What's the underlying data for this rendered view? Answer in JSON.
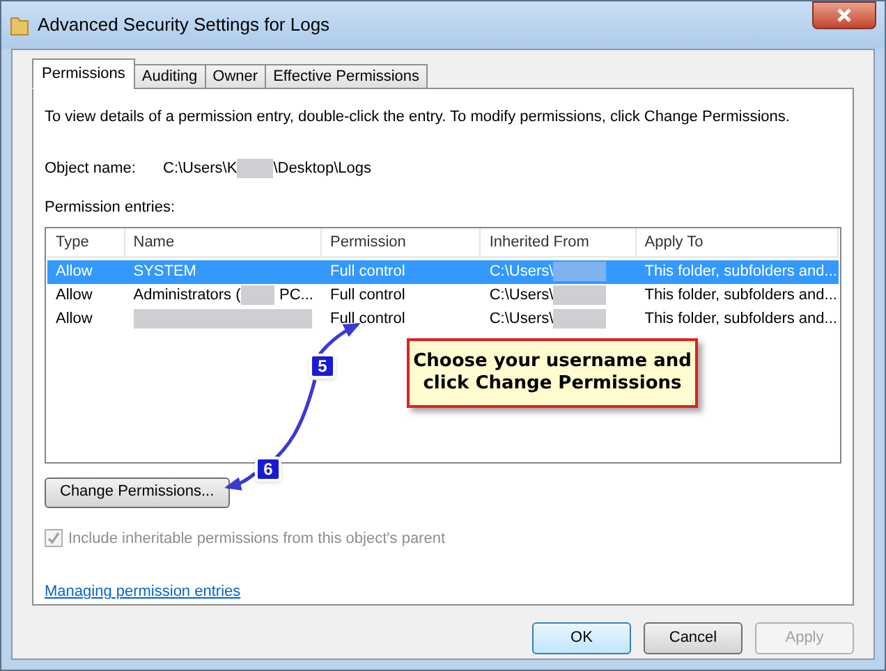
{
  "window": {
    "title": "Advanced Security Settings for Logs"
  },
  "tabs": [
    {
      "label": "Permissions",
      "selected": true
    },
    {
      "label": "Auditing",
      "selected": false
    },
    {
      "label": "Owner",
      "selected": false
    },
    {
      "label": "Effective Permissions",
      "selected": false
    }
  ],
  "description": "To view details of a permission entry, double-click the entry. To modify permissions, click Change Permissions.",
  "object_name": {
    "label": "Object name:",
    "path_start": "C:\\Users\\K",
    "path_end": "\\Desktop\\Logs"
  },
  "entries_label": "Permission entries:",
  "table": {
    "columns": [
      "Type",
      "Name",
      "Permission",
      "Inherited From",
      "Apply To"
    ],
    "rows": [
      {
        "type": "Allow",
        "name_parts": [
          "SYSTEM"
        ],
        "permission": "Full control",
        "inherited_from": "C:\\Users\\",
        "apply_to": "This folder, subfolders and...",
        "selected": true
      },
      {
        "type": "Allow",
        "name_parts": [
          "Administrators (",
          "PC..."
        ],
        "permission": "Full control",
        "inherited_from": "C:\\Users\\",
        "apply_to": "This folder, subfolders and...",
        "selected": false
      },
      {
        "type": "Allow",
        "permission": "Full control",
        "inherited_from": "C:\\Users\\",
        "apply_to": "This folder, subfolders and...",
        "selected": false
      }
    ]
  },
  "change_button": "Change Permissions...",
  "inherit_checkbox": {
    "label": "Include inheritable permissions from this object's parent",
    "checked": true,
    "disabled": true
  },
  "help_link": "Managing permission entries",
  "buttons": [
    {
      "label": "OK",
      "disabled": false,
      "default": true
    },
    {
      "label": "Cancel",
      "disabled": false,
      "default": false
    },
    {
      "label": "Apply",
      "disabled": true,
      "default": false
    }
  ],
  "annotation": {
    "callout": "Choose your username and click Change Permissions",
    "badges": [
      "5",
      "6"
    ]
  }
}
